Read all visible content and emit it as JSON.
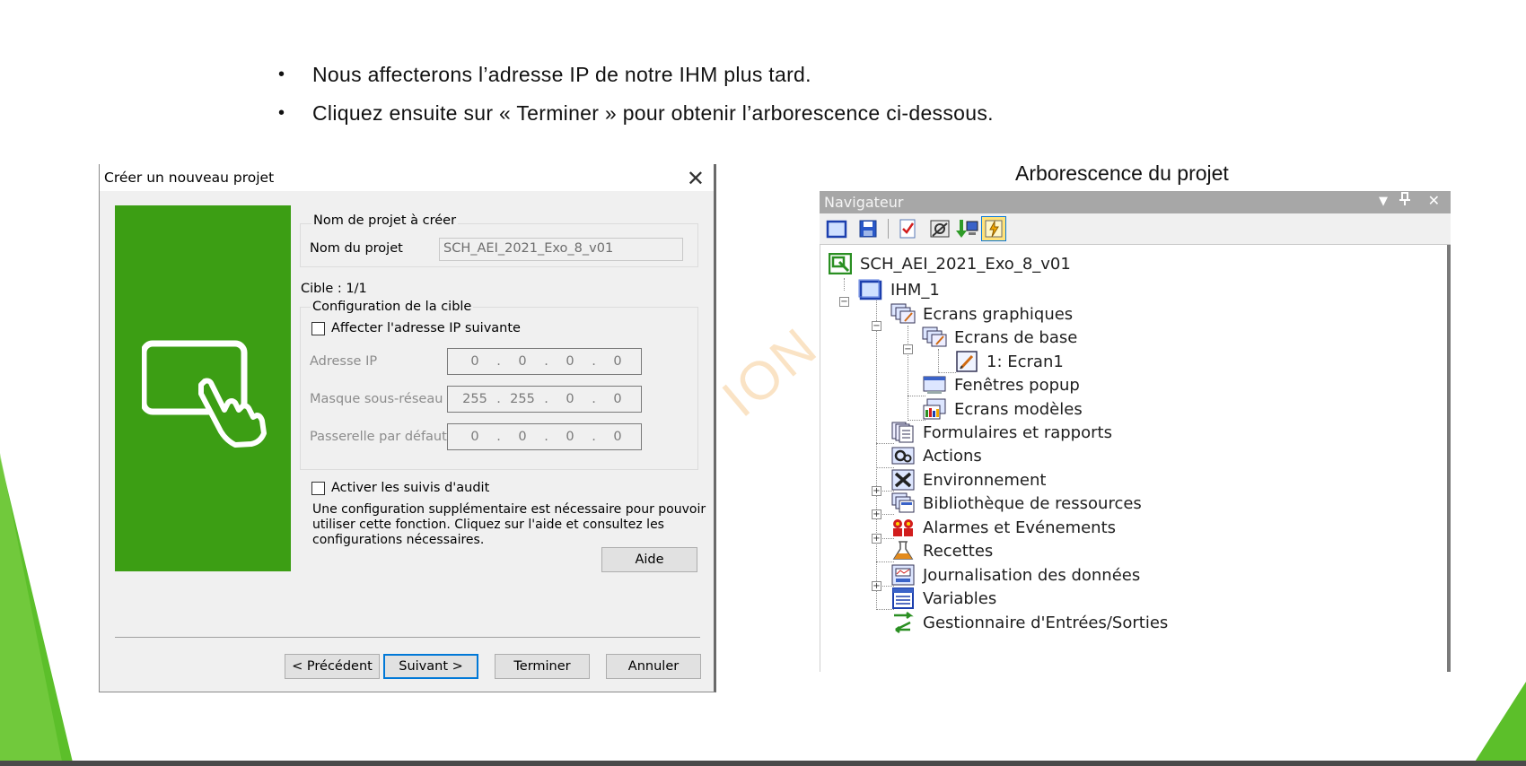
{
  "slide": {
    "bullets": [
      "Nous affecterons l’adresse IP de notre IHM plus tard.",
      "Cliquez ensuite sur « Terminer » pour obtenir l’arborescence ci-dessous."
    ],
    "bullet_glyph": "•",
    "watermark": "ION",
    "accent_color": "#5cbf2a"
  },
  "dialog": {
    "title": "Créer un nouveau projet",
    "close_glyph": "✕",
    "project_group": {
      "title": "Nom de projet à créer",
      "name_label": "Nom du projet",
      "name_value": "SCH_AEI_2021_Exo_8_v01"
    },
    "target_count": "Cible : 1/1",
    "target_group": {
      "title": "Configuration de la cible",
      "assign_ip_label": "Affecter l'adresse IP suivante",
      "assign_ip_checked": false,
      "ip_label": "Adresse IP",
      "ip_value": [
        "0",
        "0",
        "0",
        "0"
      ],
      "mask_label": "Masque sous-réseau",
      "mask_value": [
        "255",
        "255",
        "0",
        "0"
      ],
      "gateway_label": "Passerelle par défaut",
      "gateway_value": [
        "0",
        "0",
        "0",
        "0"
      ]
    },
    "audit": {
      "label": "Activer les suivis d'audit",
      "checked": false,
      "description_lines": [
        "Une configuration supplémentaire est nécessaire pour pouvoir",
        "utiliser cette fonction. Cliquez sur l'aide et consultez les",
        "configurations nécessaires."
      ],
      "help_button": "Aide"
    },
    "buttons": {
      "previous": "< Précédent",
      "next": "Suivant >",
      "finish": "Terminer",
      "cancel": "Annuler"
    },
    "panel_color": "#3c9e14"
  },
  "tree_panel": {
    "heading": "Arborescence du projet",
    "title": "Navigateur",
    "controls": [
      "▼",
      "📌",
      "✕"
    ],
    "toolbar_icons": [
      "new-screen-icon",
      "save-icon",
      "checklist-icon",
      "settings-icon",
      "download-icon",
      "transfer-icon"
    ],
    "items": [
      {
        "label": "SCH_AEI_2021_Exo_8_v01",
        "icon": "project-icon"
      },
      {
        "label": "IHM_1",
        "icon": "hmi-icon",
        "expander": "−"
      },
      {
        "label": "Ecrans graphiques",
        "icon": "screens-icon",
        "expander": "−"
      },
      {
        "label": "Ecrans de base",
        "icon": "base-screens-icon",
        "expander": "−"
      },
      {
        "label": "1: Ecran1",
        "icon": "screen-page-icon"
      },
      {
        "label": "Fenêtres popup",
        "icon": "popup-icon"
      },
      {
        "label": "Ecrans modèles",
        "icon": "template-screens-icon"
      },
      {
        "label": "Formulaires et rapports",
        "icon": "forms-icon"
      },
      {
        "label": "Actions",
        "icon": "actions-icon"
      },
      {
        "label": "Environnement",
        "icon": "environment-icon",
        "expander": "+"
      },
      {
        "label": "Bibliothèque de ressources",
        "icon": "library-icon",
        "expander": "+"
      },
      {
        "label": "Alarmes et Evénements",
        "icon": "alarms-icon",
        "expander": "+"
      },
      {
        "label": "Recettes",
        "icon": "recipes-icon"
      },
      {
        "label": "Journalisation des données",
        "icon": "logging-icon",
        "expander": "+"
      },
      {
        "label": "Variables",
        "icon": "variables-icon"
      },
      {
        "label": "Gestionnaire d'Entrées/Sorties",
        "icon": "io-manager-icon"
      }
    ]
  }
}
